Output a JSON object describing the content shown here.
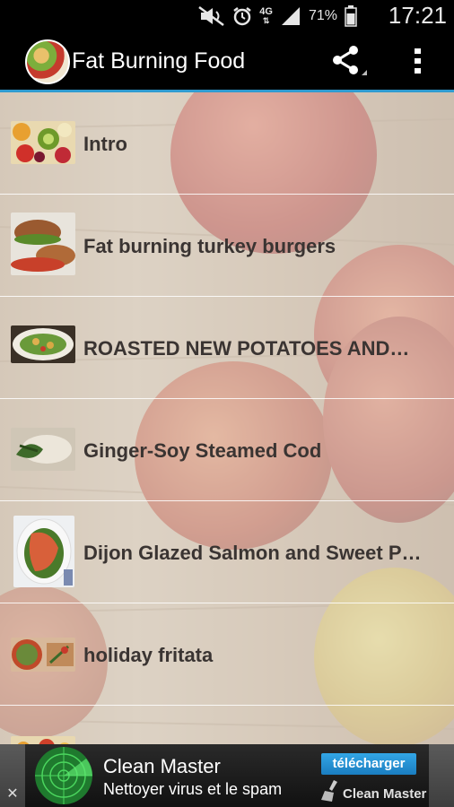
{
  "status": {
    "battery_percent": "71%",
    "time": "17:21",
    "network": "4G"
  },
  "app": {
    "title": "Fat Burning Food"
  },
  "list": {
    "items": [
      {
        "label": "Intro",
        "thumb": "fruit-salad"
      },
      {
        "label": "Fat burning turkey burgers",
        "thumb": "burgers"
      },
      {
        "label": "ROASTED NEW POTATOES AND…",
        "thumb": "salad-bowl"
      },
      {
        "label": "Ginger-Soy Steamed Cod",
        "thumb": "steamed-cod"
      },
      {
        "label": "Dijon Glazed Salmon and Sweet P…",
        "thumb": "salmon"
      },
      {
        "label": "holiday fritata",
        "thumb": "fritata"
      },
      {
        "label": "",
        "thumb": "partial"
      }
    ]
  },
  "ad": {
    "title": "Clean Master",
    "subtitle": "Nettoyer virus et le spam",
    "cta": "télécharger",
    "brand": "Clean Master",
    "close": "✕"
  },
  "colors": {
    "accent": "#2f9bd0",
    "actionbar": "#000000",
    "text": "#3a3432"
  }
}
